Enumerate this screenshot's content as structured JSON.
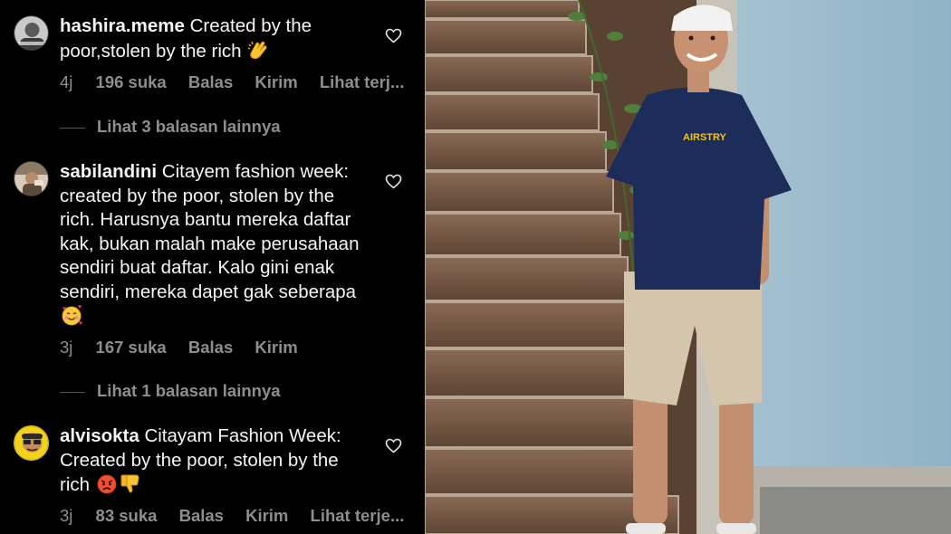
{
  "comments": [
    {
      "username": "hashira.meme",
      "text": "Created by the poor,stolen by the rich",
      "emoji_icon": "clapping-hands-icon",
      "time": "4j",
      "likes": "196 suka",
      "reply_label": "Balas",
      "send_label": "Kirim",
      "translate_label": "Lihat terj..."
    },
    {
      "username": "sabilandini",
      "text": "Citayem fashion week: created by the poor, stolen by the rich. Harusnya bantu mereka daftar kak, bukan malah make perusahaan sendiri buat daftar. Kalo gini enak sendiri, mereka dapet gak seberapa",
      "emoji_icon": "smiling-face-with-hearts-icon",
      "time": "3j",
      "likes": "167 suka",
      "reply_label": "Balas",
      "send_label": "Kirim"
    },
    {
      "username": "alvisokta",
      "text": "Citayam Fashion Week: Created by the poor, stolen by the rich",
      "emoji_icons": [
        "angry-face-icon",
        "thumbs-down-icon"
      ],
      "time": "3j",
      "likes": "83 suka",
      "reply_label": "Balas",
      "send_label": "Kirim",
      "translate_label": "Lihat terje..."
    }
  ],
  "replies": [
    {
      "label": "Lihat 3 balasan lainnya"
    },
    {
      "label": "Lihat 1 balasan lainnya"
    }
  ],
  "photo": {
    "shirt_print": "AIRSTRY"
  },
  "colors": {
    "background": "#000000",
    "text": "#f5f5f5",
    "muted": "#8e8e8e"
  }
}
